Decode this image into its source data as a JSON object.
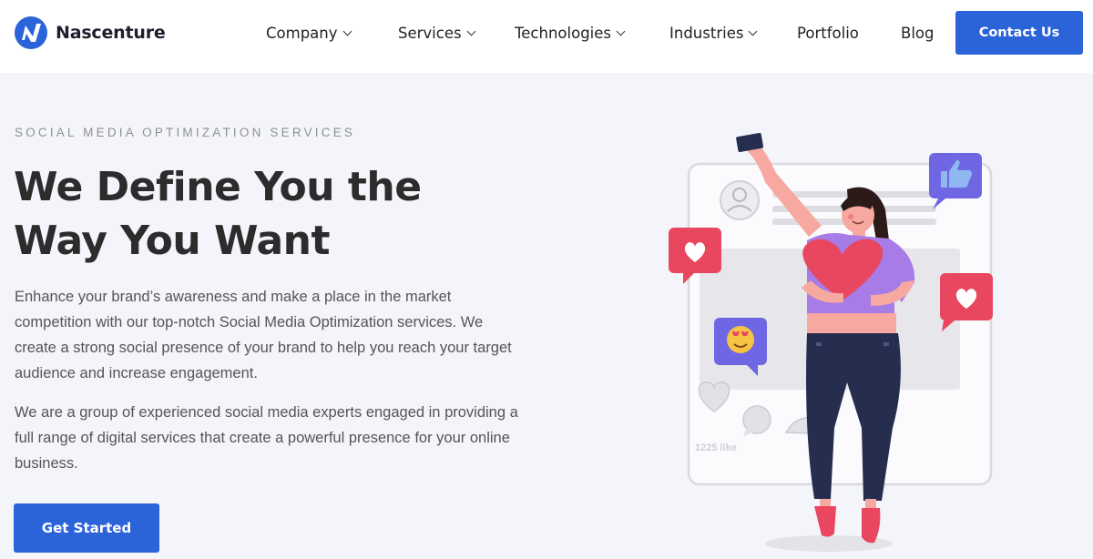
{
  "brand": {
    "name": "Nascenture",
    "accent": "#2b63d9"
  },
  "nav": {
    "items": [
      {
        "label": "Company",
        "has_dropdown": true
      },
      {
        "label": "Services",
        "has_dropdown": true
      },
      {
        "label": "Technologies",
        "has_dropdown": true
      },
      {
        "label": "Industries",
        "has_dropdown": true
      },
      {
        "label": "Portfolio",
        "has_dropdown": false
      },
      {
        "label": "Blog",
        "has_dropdown": false
      }
    ],
    "cta_label": "Contact Us"
  },
  "hero": {
    "eyebrow": "SOCIAL MEDIA OPTIMIZATION SERVICES",
    "headline_line1": "We Define You the",
    "headline_line2": "Way You Want",
    "paragraph1": "Enhance your brand’s awareness and make a place in the market competition with our top-notch Social Media Optimization services. We create a strong social presence of your brand to help you reach your target audience and increase engagement.",
    "paragraph2": "We are a group of experienced social media experts engaged in providing a full range of digital services that create a powerful presence for your online business.",
    "cta_label": "Get Started"
  },
  "illustration": {
    "likes_text": "1225 like",
    "icons": [
      "heart-icon",
      "like-icon",
      "emoji-icon",
      "profile-icon",
      "comment-icon",
      "share-icon",
      "phone-icon"
    ]
  }
}
